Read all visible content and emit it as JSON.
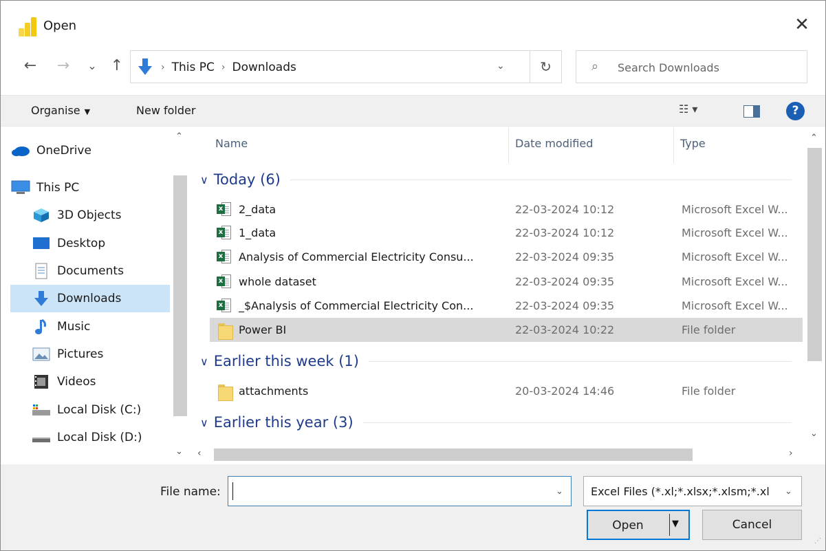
{
  "window": {
    "title": "Open",
    "close_glyph": "✕"
  },
  "nav": {
    "back_glyph": "←",
    "forward_glyph": "→",
    "recent_glyph": "⌄",
    "up_glyph": "↑"
  },
  "address": {
    "crumbs": [
      "This PC",
      "Downloads"
    ],
    "separator": "›",
    "dropdown_glyph": "⌄",
    "refresh_glyph": "↻"
  },
  "search": {
    "placeholder": "Search Downloads",
    "icon_glyph": "⌕"
  },
  "commandbar": {
    "organise_label": "Organise",
    "new_folder_label": "New folder",
    "view_glyph": "☷ ▾",
    "help_glyph": "?"
  },
  "sidebar": {
    "items": [
      {
        "label": "OneDrive",
        "icon": "onedrive-icon"
      },
      {
        "label": "This PC",
        "icon": "this-pc-icon"
      },
      {
        "label": "3D Objects",
        "icon": "3d-objects-icon"
      },
      {
        "label": "Desktop",
        "icon": "desktop-icon"
      },
      {
        "label": "Documents",
        "icon": "documents-icon"
      },
      {
        "label": "Downloads",
        "icon": "downloads-icon",
        "selected": true
      },
      {
        "label": "Music",
        "icon": "music-icon"
      },
      {
        "label": "Pictures",
        "icon": "pictures-icon"
      },
      {
        "label": "Videos",
        "icon": "videos-icon"
      },
      {
        "label": "Local Disk (C:)",
        "icon": "local-disk-icon"
      },
      {
        "label": "Local Disk (D:)",
        "icon": "local-disk-icon"
      }
    ]
  },
  "columns": {
    "name": "Name",
    "date": "Date modified",
    "type": "Type"
  },
  "groups": [
    {
      "label": "Today (6)",
      "files": [
        {
          "name": "2_data",
          "date": "22-03-2024 10:12",
          "type": "Microsoft Excel W...",
          "icon": "excel-file-icon"
        },
        {
          "name": "1_data",
          "date": "22-03-2024 10:12",
          "type": "Microsoft Excel W...",
          "icon": "excel-file-icon"
        },
        {
          "name": "Analysis of Commercial Electricity Consu...",
          "date": "22-03-2024 09:35",
          "type": "Microsoft Excel W...",
          "icon": "excel-file-icon"
        },
        {
          "name": "whole dataset",
          "date": "22-03-2024 09:35",
          "type": "Microsoft Excel W...",
          "icon": "excel-file-icon"
        },
        {
          "name": "_$Analysis of Commercial Electricity Con...",
          "date": "22-03-2024 09:35",
          "type": "Microsoft Excel W...",
          "icon": "excel-file-icon"
        },
        {
          "name": "Power BI",
          "date": "22-03-2024 10:22",
          "type": "File folder",
          "icon": "folder-icon",
          "selected": true
        }
      ]
    },
    {
      "label": "Earlier this week (1)",
      "files": [
        {
          "name": "attachments",
          "date": "20-03-2024 14:46",
          "type": "File folder",
          "icon": "folder-icon"
        }
      ]
    },
    {
      "label": "Earlier this year (3)",
      "files": []
    }
  ],
  "footer": {
    "file_name_label": "File name:",
    "file_name_value": "",
    "filter_value": "Excel Files (*.xl;*.xlsx;*.xlsm;*.xl",
    "open_label": "Open",
    "cancel_label": "Cancel"
  },
  "colors": {
    "accent": "#0078d7",
    "selected_nav": "#cce4f7",
    "selected_row": "#d9d9d9",
    "group_header": "#1e3a8a",
    "excel_green": "#1d6f42",
    "folder_yellow": "#f8d775",
    "powerbi_yellow": "#f2c811"
  }
}
